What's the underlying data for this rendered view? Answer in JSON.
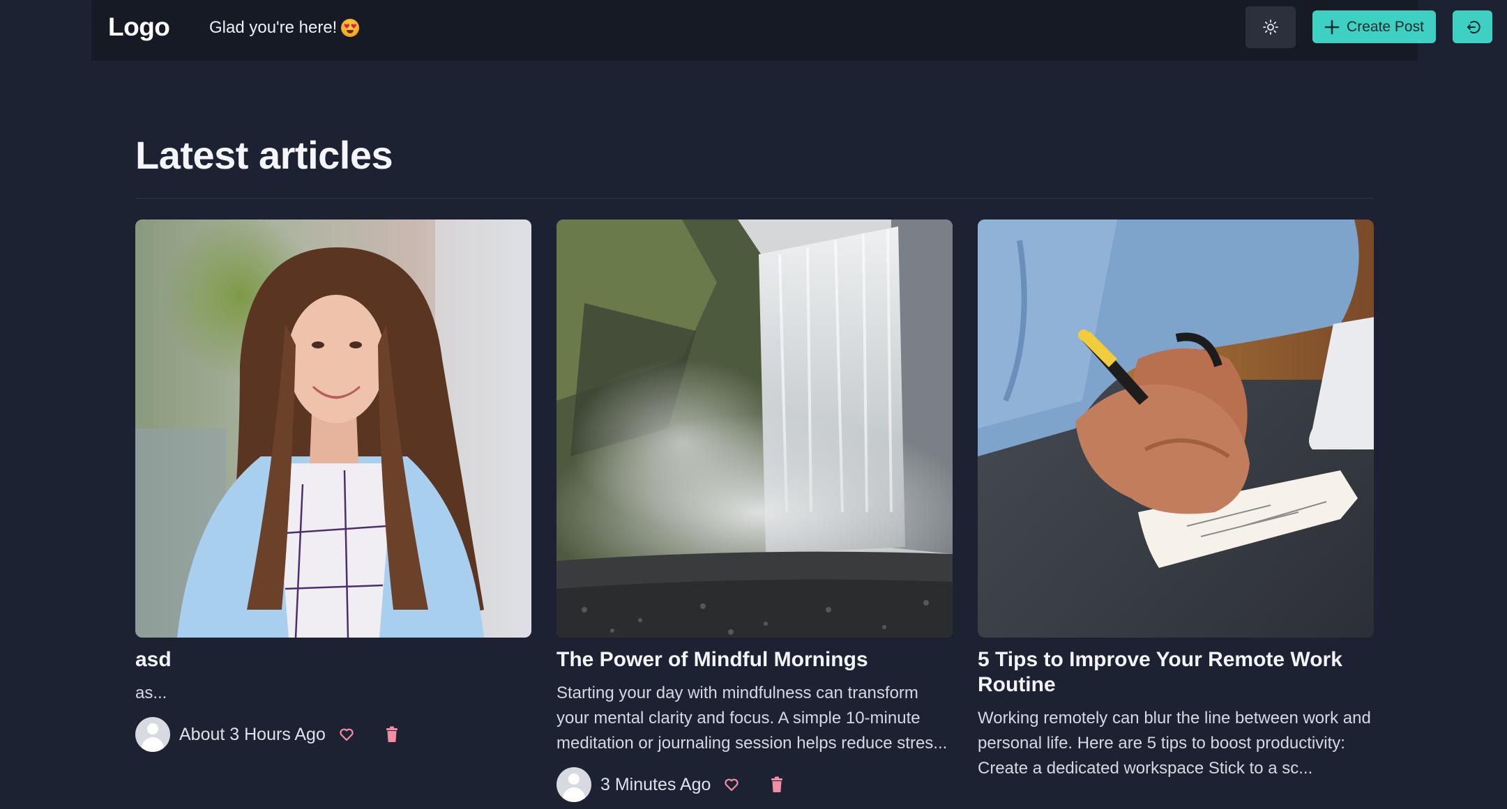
{
  "header": {
    "logo": "Logo",
    "greeting": "Glad you're here!",
    "create_label": "Create Post",
    "theme_icon": "sun-icon",
    "logout_icon": "logout-icon"
  },
  "main": {
    "title": "Latest articles"
  },
  "articles": [
    {
      "title": "asd",
      "excerpt": "as...",
      "time": "About 3 Hours Ago",
      "image": "photo-woman-portrait"
    },
    {
      "title": "The Power of Mindful Mornings",
      "excerpt": "Starting your day with mindfulness can transform your mental clarity and focus. A simple 10-minute meditation or journaling session helps reduce stres...",
      "time": "3 Minutes Ago",
      "image": "photo-waterfall"
    },
    {
      "title": "5 Tips to Improve Your Remote Work Routine",
      "excerpt": "Working remotely can blur the line between work and personal life. Here are 5 tips to boost productivity: Create a dedicated workspace Stick to a sc...",
      "time": "",
      "image": "photo-hand-writing"
    }
  ],
  "colors": {
    "background": "#1d2232",
    "navbar": "#151a24",
    "accent": "#3ed1c3",
    "like": "#f08fa3",
    "delete": "#f08fa3"
  }
}
